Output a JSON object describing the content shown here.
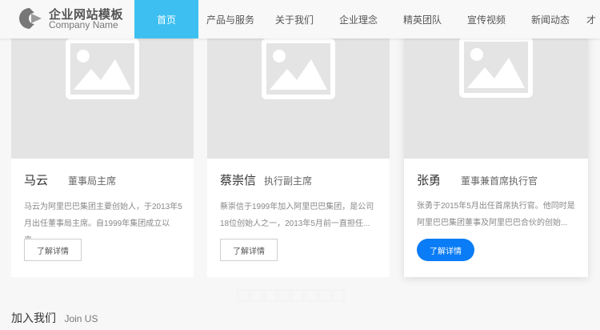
{
  "header": {
    "logo_title": "企业网站模板",
    "logo_subtitle": "Company Name",
    "nav": [
      {
        "label": "首页",
        "active": true
      },
      {
        "label": "产品与服务",
        "active": false
      },
      {
        "label": "关于我们",
        "active": false
      },
      {
        "label": "企业理念",
        "active": false
      },
      {
        "label": "精英团队",
        "active": false
      },
      {
        "label": "宣传视频",
        "active": false
      },
      {
        "label": "新闻动态",
        "active": false
      },
      {
        "label": "才",
        "active": false
      }
    ]
  },
  "team": [
    {
      "name": "马云",
      "title": "董事局主席",
      "desc_line1": "马云为阿里巴巴集团主要创始人，于2013年5",
      "desc_line2": "月出任董事局主席。自1999年集团成立以来...",
      "button": "了解详情",
      "highlighted": false
    },
    {
      "name": "蔡崇信",
      "title": "执行副主席",
      "desc_line1": "蔡崇信于1999年加入阿里巴巴集团，是公司",
      "desc_line2": "18位创始人之一，2013年5月前一直担任...",
      "button": "了解详情",
      "highlighted": false
    },
    {
      "name": "张勇",
      "title": "董事兼首席执行官",
      "desc_line1": "张勇于2015年5月出任首席执行官。他同时是",
      "desc_line2": "阿里巴巴集团董事及阿里巴巴合伙的创始...",
      "button": "了解详情",
      "highlighted": true
    }
  ],
  "join": {
    "title": "加入我们",
    "subtitle": "Join US"
  },
  "colors": {
    "nav_active": "#3dc0f1",
    "primary_button": "#0a7cf5",
    "image_placeholder": "#e4e4e4"
  }
}
